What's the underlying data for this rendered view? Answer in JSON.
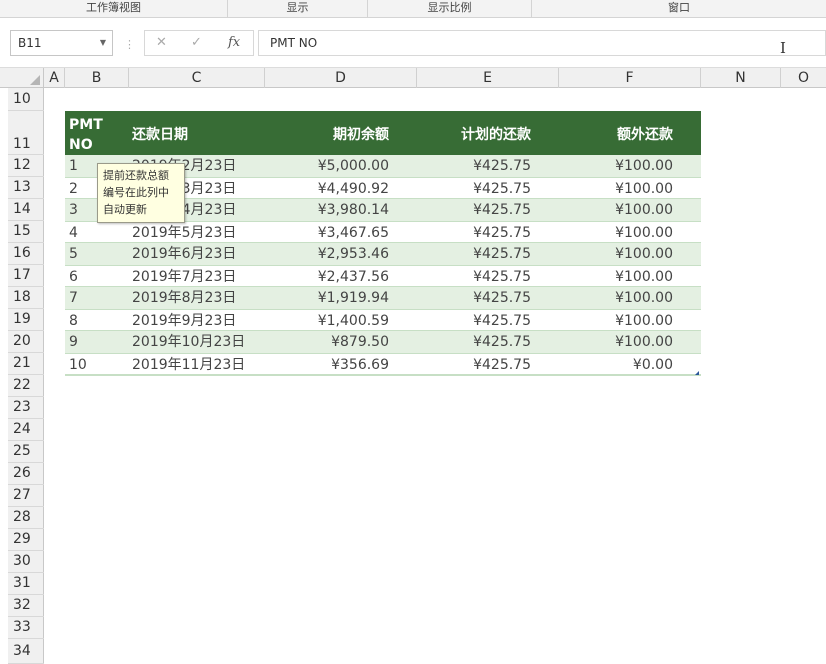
{
  "ribbon": {
    "groups": [
      "工作簿视图",
      "显示",
      "显示比例",
      "窗口"
    ]
  },
  "formula_bar": {
    "name_box": "B11",
    "cancel_icon": "✕",
    "enter_icon": "✓",
    "fx_label": "fx",
    "formula": "PMT NO"
  },
  "columns": [
    "A",
    "B",
    "C",
    "D",
    "E",
    "F",
    "N",
    "O"
  ],
  "rows": [
    "10",
    "11",
    "12",
    "13",
    "14",
    "15",
    "16",
    "17",
    "18",
    "19",
    "20",
    "21",
    "22",
    "23",
    "24",
    "25",
    "26",
    "27",
    "28",
    "29",
    "30",
    "31",
    "32",
    "33",
    "34"
  ],
  "table": {
    "headers": {
      "pmt_no_line1": "PMT",
      "pmt_no_line2": "NO",
      "date": "还款日期",
      "opening": "期初余额",
      "scheduled": "计划的还款",
      "extra": "额外还款"
    },
    "rows": [
      {
        "no": "1",
        "date": "2019年2月23日",
        "opening": "¥5,000.00",
        "scheduled": "¥425.75",
        "extra": "¥100.00"
      },
      {
        "no": "2",
        "date": "2019年3月23日",
        "opening": "¥4,490.92",
        "scheduled": "¥425.75",
        "extra": "¥100.00"
      },
      {
        "no": "3",
        "date": "2019年4月23日",
        "opening": "¥3,980.14",
        "scheduled": "¥425.75",
        "extra": "¥100.00"
      },
      {
        "no": "4",
        "date": "2019年5月23日",
        "opening": "¥3,467.65",
        "scheduled": "¥425.75",
        "extra": "¥100.00"
      },
      {
        "no": "5",
        "date": "2019年6月23日",
        "opening": "¥2,953.46",
        "scheduled": "¥425.75",
        "extra": "¥100.00"
      },
      {
        "no": "6",
        "date": "2019年7月23日",
        "opening": "¥2,437.56",
        "scheduled": "¥425.75",
        "extra": "¥100.00"
      },
      {
        "no": "7",
        "date": "2019年8月23日",
        "opening": "¥1,919.94",
        "scheduled": "¥425.75",
        "extra": "¥100.00"
      },
      {
        "no": "8",
        "date": "2019年9月23日",
        "opening": "¥1,400.59",
        "scheduled": "¥425.75",
        "extra": "¥100.00"
      },
      {
        "no": "9",
        "date": "2019年10月23日",
        "opening": "¥879.50",
        "scheduled": "¥425.75",
        "extra": "¥100.00"
      },
      {
        "no": "10",
        "date": "2019年11月23日",
        "opening": "¥356.69",
        "scheduled": "¥425.75",
        "extra": "¥0.00"
      }
    ]
  },
  "tooltip": {
    "line1": "提前还款总额",
    "line2": "编号在此列中",
    "line3": "自动更新"
  },
  "colors": {
    "header_green": "#376c35",
    "band_green": "#e4f0e2",
    "tooltip_bg": "#ffffe1"
  }
}
